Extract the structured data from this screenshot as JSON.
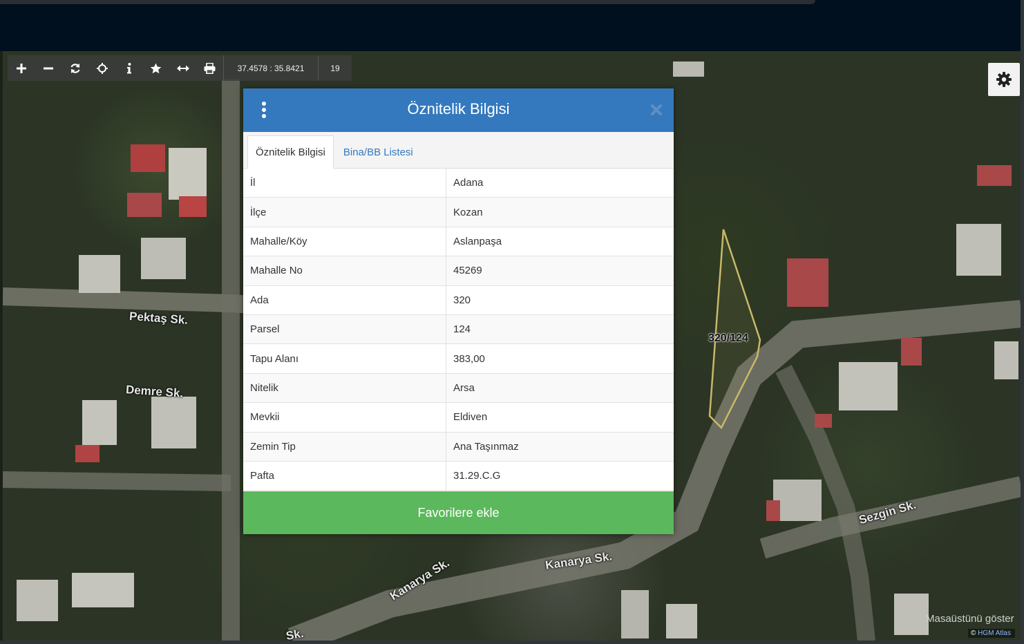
{
  "toolbar": {
    "coords": "37.4578 : 35.8421",
    "zoom": "19"
  },
  "map": {
    "streets": [
      "Pektaş Sk.",
      "Demre Sk.",
      "Kanarya Sk.",
      "Kanarya Sk.",
      "Sezgin Sk.",
      "Sk."
    ],
    "parcel_label": "320/124",
    "desktop_label": "Masaüstünü göster",
    "attribution_symbol": "©",
    "attribution_link": "HGM Atlas"
  },
  "dialog": {
    "title": "Öznitelik Bilgisi",
    "tabs": [
      {
        "label": "Öznitelik Bilgisi",
        "active": true
      },
      {
        "label": "Bina/BB Listesi",
        "active": false
      }
    ],
    "rows": [
      {
        "key": "İl",
        "value": "Adana"
      },
      {
        "key": "İlçe",
        "value": "Kozan"
      },
      {
        "key": "Mahalle/Köy",
        "value": "Aslanpaşa"
      },
      {
        "key": "Mahalle No",
        "value": "45269"
      },
      {
        "key": "Ada",
        "value": "320"
      },
      {
        "key": "Parsel",
        "value": "124"
      },
      {
        "key": "Tapu Alanı",
        "value": "383,00"
      },
      {
        "key": "Nitelik",
        "value": "Arsa"
      },
      {
        "key": "Mevkii",
        "value": "Eldiven"
      },
      {
        "key": "Zemin Tip",
        "value": "Ana Taşınmaz"
      },
      {
        "key": "Pafta",
        "value": "31.29.C.G"
      }
    ],
    "favorite_label": "Favorilere ekle"
  },
  "colors": {
    "header_blue": "#3479be",
    "favorite_green": "#5cb85c",
    "parcel_outline": "#c8b96a"
  }
}
